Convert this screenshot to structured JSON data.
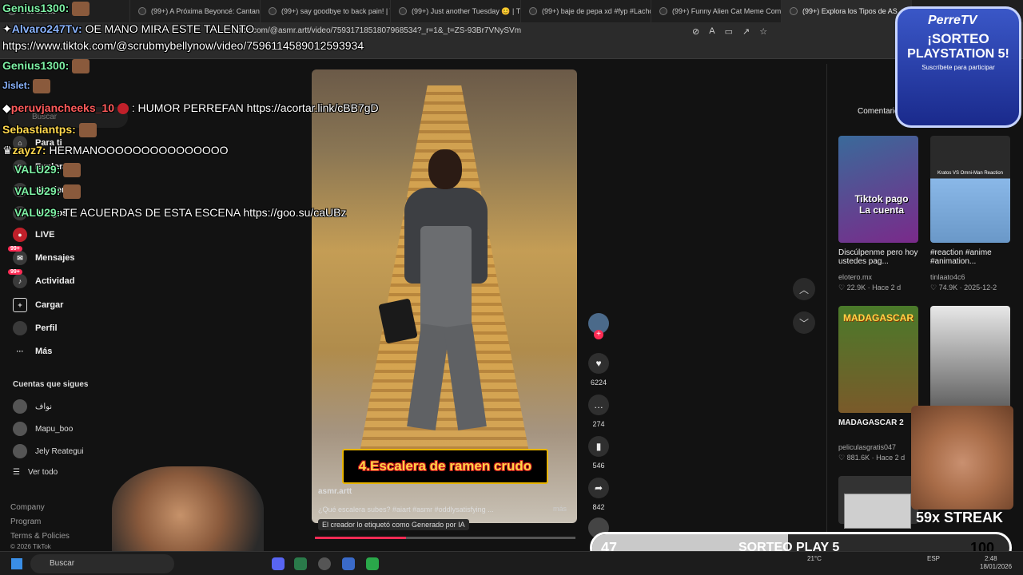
{
  "browser": {
    "tabs": [
      {
        "label": "s de la Inte"
      },
      {
        "label": "(99+) A Próxima Beyoncé: Cantando"
      },
      {
        "label": "(99+) say goodbye to back pain! | Tik"
      },
      {
        "label": "(99+) Just another Tuesday 😊 | TikT"
      },
      {
        "label": "(99+) baje de pepa xd #fyp #Lacholi"
      },
      {
        "label": "(99+) Funny Alien Cat Meme Comple"
      },
      {
        "label": "(99+) Explora los Tipos de AS",
        "active": true
      }
    ],
    "url": "tiktok.com/@asmr.artt/video/7593171851807968534?_r=1&_t=ZS-93Br7VNySVm"
  },
  "sidebar": {
    "search_placeholder": "Buscar",
    "nav": [
      {
        "label": "Para ti",
        "icon": "home-icon"
      },
      {
        "label": "Explorar",
        "icon": "compass-icon"
      },
      {
        "label": "Siguiendo",
        "icon": "users-icon"
      },
      {
        "label": "Amigos",
        "icon": "friends-icon"
      },
      {
        "label": "LIVE",
        "icon": "live-icon"
      },
      {
        "label": "Mensajes",
        "icon": "message-icon",
        "badge": "99+"
      },
      {
        "label": "Actividad",
        "icon": "bell-icon",
        "badge": "99+"
      },
      {
        "label": "Cargar",
        "icon": "plus-square-icon"
      },
      {
        "label": "Perfil",
        "icon": "avatar-icon"
      },
      {
        "label": "Más",
        "icon": "more-icon"
      }
    ],
    "following_title": "Cuentas que sigues",
    "following": [
      {
        "name": "نواف"
      },
      {
        "name": "Mapu_boo"
      },
      {
        "name": "Jely Reategui"
      }
    ],
    "see_all": "Ver todo",
    "footer": [
      "Company",
      "Program",
      "Terms & Policies",
      "© 2026 TikTok"
    ]
  },
  "chat": [
    {
      "user": "Genius1300:",
      "text": "",
      "color": "green"
    },
    {
      "user": "Alvaro247Tv:",
      "text": "OE MANO MIRA ESTE TALENTO",
      "color": "blue"
    },
    {
      "user": "",
      "text": "https://www.tiktok.com/@scrubmybellynow/video/7596114589012593934",
      "color": ""
    },
    {
      "user": "Genius1300:",
      "text": "",
      "color": "green"
    },
    {
      "user": "Jislet:",
      "text": "",
      "color": "blue"
    },
    {
      "user": "peruvjancheeks_10",
      "text": ": HUMOR PERREFAN https://acortar.link/cBB7gD",
      "color": "red"
    },
    {
      "user": "Sebastiantps:",
      "text": "",
      "color": "yellow"
    },
    {
      "user": "zayz7:",
      "text": "HERMANOOOOOOOOOOOOOOO",
      "color": "yellow"
    },
    {
      "user": "VALU29:",
      "text": "",
      "color": "green"
    },
    {
      "user": "VALU29:",
      "text": "",
      "color": "green"
    },
    {
      "user": "VALU29:",
      "text": "TE ACUERDAS DE ESTA ESCENA https://goo.su/caUBz",
      "color": "green"
    }
  ],
  "video": {
    "caption_overlay": "4.Escalera de ramen crudo",
    "author": "asmr.artt",
    "description": "¿Qué escalera subes? #aiart #asmr #oddlysatisfying ...",
    "more": "más",
    "ai_label": "El creador lo etiquetó como Generado por IA",
    "progress": 0.35
  },
  "actions": {
    "likes": "6224",
    "comments": "274",
    "saves": "546",
    "shares": "842"
  },
  "right_panel": {
    "tab": "Comentarios",
    "cards": [
      {
        "title": "Discúlpenme pero hoy ustedes pag...",
        "author": "elotero.mx",
        "stats": "♡ 22.9K · Hace 2 d",
        "thumb_text": "Tiktok pago La cuenta"
      },
      {
        "title": "#reaction #anime #animation...",
        "author": "tinlaato4c6",
        "stats": "♡ 74.9K · 2025-12-2",
        "thumb_text": "Kratos VS Omni-Man Reaction"
      },
      {
        "title": "MADAGASCAR 2",
        "author": "peliculasgratis047",
        "stats": "♡ 881.6K · Hace 2 d",
        "thumb_text": "MADAGASCAR"
      },
      {
        "title": "",
        "author": "",
        "stats": "",
        "thumb_text": ""
      }
    ]
  },
  "overlay": {
    "sorteo_title": "PerreTV",
    "sorteo_line1": "¡SORTEO",
    "sorteo_line2": "PLAYSTATION 5!",
    "sorteo_sub": "Suscríbete para participar",
    "streak": "59x STREAK",
    "goal_current": "47",
    "goal_label": "SORTEO PLAY 5",
    "goal_target": "100",
    "goal_fraction": 0.47
  },
  "taskbar": {
    "search": "Buscar",
    "weather": "21°C",
    "lang": "ESP",
    "time": "2:48",
    "date": "18/01/2026"
  },
  "colors": {
    "accent": "#fe2c55",
    "background": "#121212"
  }
}
